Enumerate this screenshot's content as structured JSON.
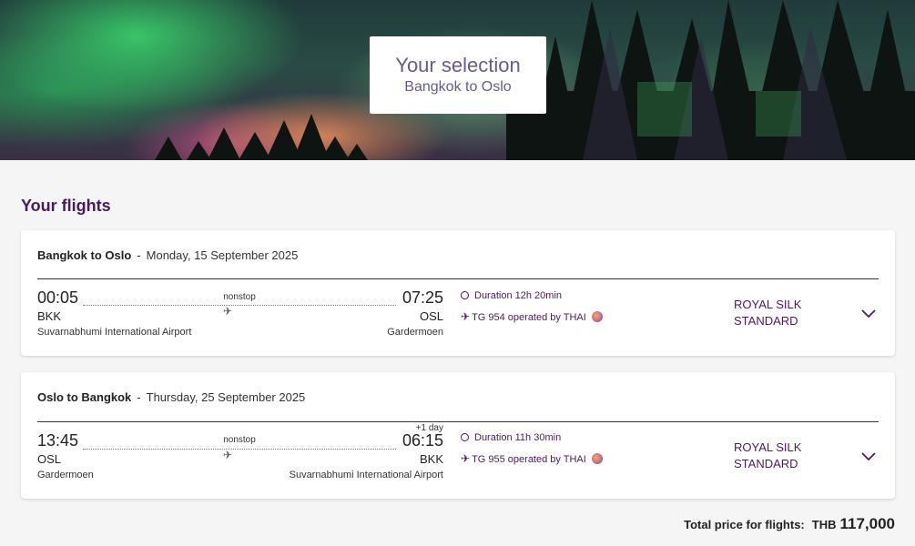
{
  "hero": {
    "title": "Your selection",
    "subtitle": "Bangkok to Oslo"
  },
  "section_title": "Your flights",
  "flights": [
    {
      "route": "Bangkok to Oslo",
      "separator": "-",
      "date": "Monday, 15 September 2025",
      "depart_time": "00:05",
      "depart_code": "BKK",
      "depart_airport": "Suvarnabhumi International Airport",
      "stops": "nonstop",
      "arrive_time": "07:25",
      "arrive_code": "OSL",
      "arrive_airport": "Gardermoen",
      "day_offset": "",
      "duration": "Duration 12h 20min",
      "flight_info": "TG 954 operated by THAI",
      "fare_line1": "ROYAL SILK",
      "fare_line2": "STANDARD"
    },
    {
      "route": "Oslo to Bangkok",
      "separator": "-",
      "date": "Thursday, 25 September 2025",
      "depart_time": "13:45",
      "depart_code": "OSL",
      "depart_airport": "Gardermoen",
      "stops": "nonstop",
      "arrive_time": "06:15",
      "arrive_code": "BKK",
      "arrive_airport": "Suvarnabhumi International Airport",
      "day_offset": "+1 day",
      "duration": "Duration 11h 30min",
      "flight_info": "TG 955 operated by THAI",
      "fare_line1": "ROYAL SILK",
      "fare_line2": "STANDARD"
    }
  ],
  "total": {
    "label": "Total price for flights:",
    "currency": "THB",
    "amount": "117,000"
  },
  "colors": {
    "accent": "#4a1a5e",
    "hero_text": "#6a5a85"
  },
  "icons": [
    "clock-icon",
    "plane-icon",
    "airline-logo-icon",
    "chevron-down-icon"
  ]
}
